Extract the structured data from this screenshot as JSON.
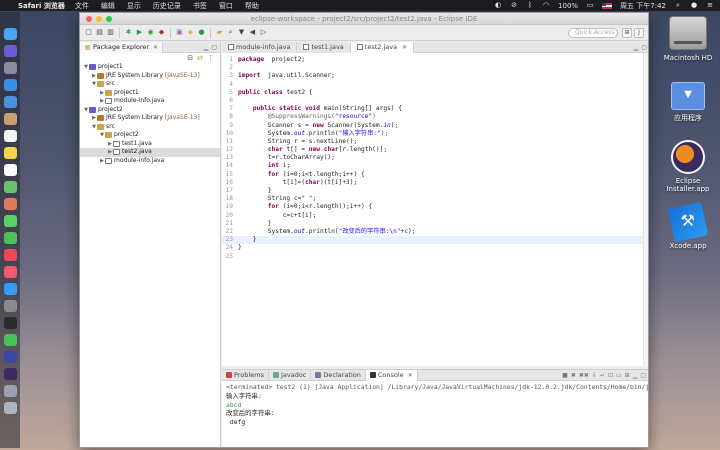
{
  "menubar": {
    "app": "Safari 浏览器",
    "menus": [
      "文件",
      "编辑",
      "显示",
      "历史记录",
      "书签",
      "窗口",
      "帮助"
    ],
    "battery": "100%",
    "datetime": "周五 下午7:42"
  },
  "desktop": {
    "items": [
      {
        "label": "Macintosh HD",
        "icon": "hard-drive-icon"
      },
      {
        "label": "应用程序",
        "icon": "folder-icon"
      },
      {
        "label": "Eclipse Installer.app",
        "icon": "eclipse-installer-icon"
      },
      {
        "label": "Xcode.app",
        "icon": "xcode-icon"
      }
    ]
  },
  "window": {
    "title": "eclipse-workspace - project2/src/project2/test2.java - Eclipse IDE",
    "quick_access": "Quick Access"
  },
  "package_explorer": {
    "tab_label": "Package Explorer",
    "tree": [
      {
        "label": "project1",
        "indent": 0,
        "arrow": "▼",
        "icon": "proj"
      },
      {
        "label": "JRE System Library",
        "deco": "[JavaSE-13]",
        "indent": 1,
        "arrow": "▶",
        "icon": "lib"
      },
      {
        "label": "src",
        "indent": 1,
        "arrow": "▼",
        "icon": "folder-src"
      },
      {
        "label": "project1",
        "indent": 2,
        "arrow": "▶",
        "icon": "pkg"
      },
      {
        "label": "module-info.java",
        "indent": 2,
        "arrow": "▶",
        "icon": "java"
      },
      {
        "label": "project2",
        "indent": 0,
        "arrow": "▼",
        "icon": "proj"
      },
      {
        "label": "JRE System Library",
        "deco": "[JavaSE-13]",
        "indent": 1,
        "arrow": "▶",
        "icon": "lib"
      },
      {
        "label": "src",
        "indent": 1,
        "arrow": "▼",
        "icon": "folder-src"
      },
      {
        "label": "project2",
        "indent": 2,
        "arrow": "▼",
        "icon": "pkg"
      },
      {
        "label": "test1.java",
        "indent": 3,
        "arrow": "▶",
        "icon": "java"
      },
      {
        "label": "test2.java",
        "indent": 3,
        "arrow": "▶",
        "icon": "java",
        "selected": true
      },
      {
        "label": "module-info.java",
        "indent": 2,
        "arrow": "▶",
        "icon": "java"
      }
    ]
  },
  "editor": {
    "tabs": [
      {
        "label": "module-info.java",
        "active": false
      },
      {
        "label": "test1.java",
        "active": false
      },
      {
        "label": "test2.java",
        "active": true
      }
    ],
    "current_line": 23,
    "lines": [
      [
        [
          "kw",
          "package"
        ],
        [
          "",
          "  project2;"
        ]
      ],
      [],
      [
        [
          "kw",
          "import"
        ],
        [
          "",
          "  java.util.Scanner;"
        ]
      ],
      [],
      [
        [
          "kw",
          "public"
        ],
        [
          "",
          " "
        ],
        [
          "kw",
          "class"
        ],
        [
          "",
          " test2 {"
        ]
      ],
      [],
      [
        [
          "",
          "    "
        ],
        [
          "kw",
          "public"
        ],
        [
          "",
          " "
        ],
        [
          "kw",
          "static"
        ],
        [
          "",
          " "
        ],
        [
          "kw",
          "void"
        ],
        [
          "",
          " main(String[] args) {"
        ]
      ],
      [
        [
          "",
          "        "
        ],
        [
          "ann",
          "@SuppressWarnings("
        ],
        [
          "str",
          "\"resource\""
        ],
        [
          "ann",
          ")"
        ]
      ],
      [
        [
          "",
          "        Scanner s = "
        ],
        [
          "kw",
          "new"
        ],
        [
          "",
          " Scanner(System."
        ],
        [
          "fld",
          "in"
        ],
        [
          "",
          ");"
        ]
      ],
      [
        [
          "",
          "        System."
        ],
        [
          "fld",
          "out"
        ],
        [
          "",
          ".println("
        ],
        [
          "str",
          "\"输入字符串:\""
        ],
        [
          "",
          ");"
        ]
      ],
      [
        [
          "",
          "        String r = s.nextLine();"
        ]
      ],
      [
        [
          "",
          "        "
        ],
        [
          "kw",
          "char"
        ],
        [
          "",
          " t[] = "
        ],
        [
          "kw",
          "new"
        ],
        [
          "",
          " "
        ],
        [
          "kw",
          "char"
        ],
        [
          "",
          "[r.length()];"
        ]
      ],
      [
        [
          "",
          "        t=r.toCharArray();"
        ]
      ],
      [
        [
          "",
          "        "
        ],
        [
          "kw",
          "int"
        ],
        [
          "",
          " i;"
        ]
      ],
      [
        [
          "",
          "        "
        ],
        [
          "kw",
          "for"
        ],
        [
          "",
          " (i=0;i<t.length;i++) {"
        ]
      ],
      [
        [
          "",
          "            t[i]=("
        ],
        [
          "kw",
          "char"
        ],
        [
          "",
          ")(t[i]+3);"
        ]
      ],
      [
        [
          "",
          "        }"
        ]
      ],
      [
        [
          "",
          "        String c="
        ],
        [
          "str",
          "\" \""
        ],
        [
          "",
          ";"
        ]
      ],
      [
        [
          "",
          "        "
        ],
        [
          "kw",
          "for"
        ],
        [
          "",
          " (i=0;i<r.length();i++) {"
        ]
      ],
      [
        [
          "",
          "            c=c+t[i];"
        ]
      ],
      [
        [
          "",
          "        }"
        ]
      ],
      [
        [
          "",
          "        System."
        ],
        [
          "fld",
          "out"
        ],
        [
          "",
          ".println("
        ],
        [
          "str",
          "\"改变后的字符串:\\n\""
        ],
        [
          "",
          "+c);"
        ]
      ],
      [
        [
          "",
          "    }"
        ]
      ],
      [
        [
          "",
          "}"
        ]
      ],
      []
    ]
  },
  "console": {
    "tabs": [
      {
        "label": "Problems",
        "color": "#c44"
      },
      {
        "label": "Javadoc",
        "color": "#6a8"
      },
      {
        "label": "Declaration",
        "color": "#77a"
      },
      {
        "label": "Console",
        "color": "#333",
        "active": true
      }
    ],
    "terminated": "<terminated> test2 (1) [Java Application] /Library/Java/JavaVirtualMachines/jdk-12.0.2.jdk/Contents/Home/bin/java (2019年9月27日 下午7:40:57)",
    "prompt": "输入字符串:",
    "input": "abcd",
    "result_label": "改变后的字符串:",
    "result": " defg"
  }
}
